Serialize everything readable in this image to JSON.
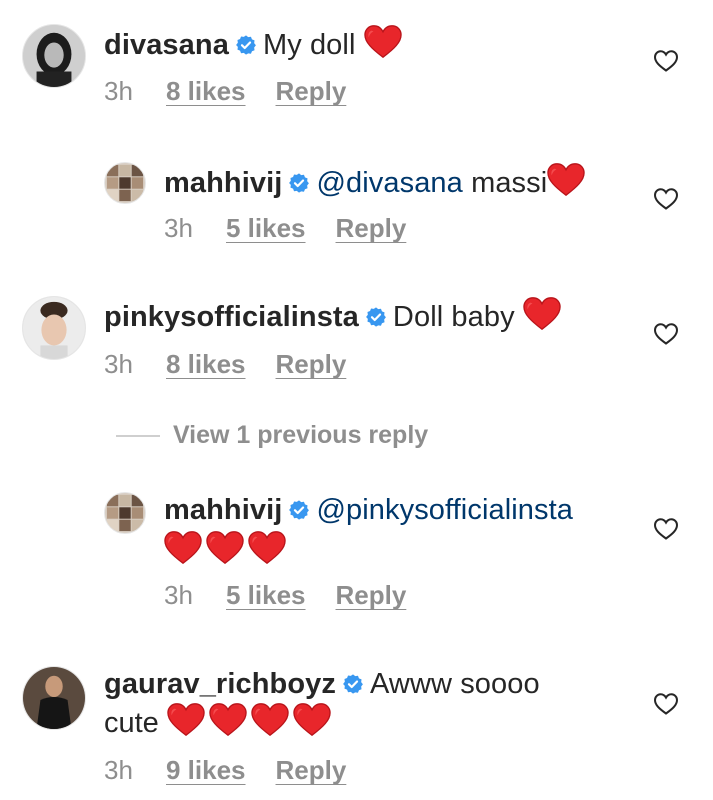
{
  "comments": [
    {
      "username": "divasana",
      "text": "My doll",
      "hearts": 1,
      "time": "3h",
      "likes": "8 likes",
      "reply": "Reply"
    },
    {
      "username": "mahhivij",
      "mention": "@divasana",
      "text": "massi",
      "hearts": 1,
      "time": "3h",
      "likes": "5 likes",
      "reply": "Reply"
    },
    {
      "username": "pinkysofficialinsta",
      "text": "Doll baby",
      "hearts": 1,
      "time": "3h",
      "likes": "8 likes",
      "reply": "Reply"
    },
    {
      "username": "mahhivij",
      "mention": "@pinkysofficialinsta",
      "hearts": 3,
      "time": "3h",
      "likes": "5 likes",
      "reply": "Reply"
    },
    {
      "username": "gaurav_richboyz",
      "text": "Awww soooo",
      "continuation": "cute",
      "hearts": 4,
      "time": "3h",
      "likes": "9 likes",
      "reply": "Reply"
    }
  ],
  "view_previous": "View 1 previous reply",
  "colors": {
    "verified": "#3897f0",
    "heart": "#ed2d2d",
    "mention": "#00376b",
    "meta": "#8e8e8e"
  },
  "icons": {
    "verified": "verified-badge-icon",
    "emoji": "red-heart-emoji",
    "like": "heart-outline-icon"
  }
}
